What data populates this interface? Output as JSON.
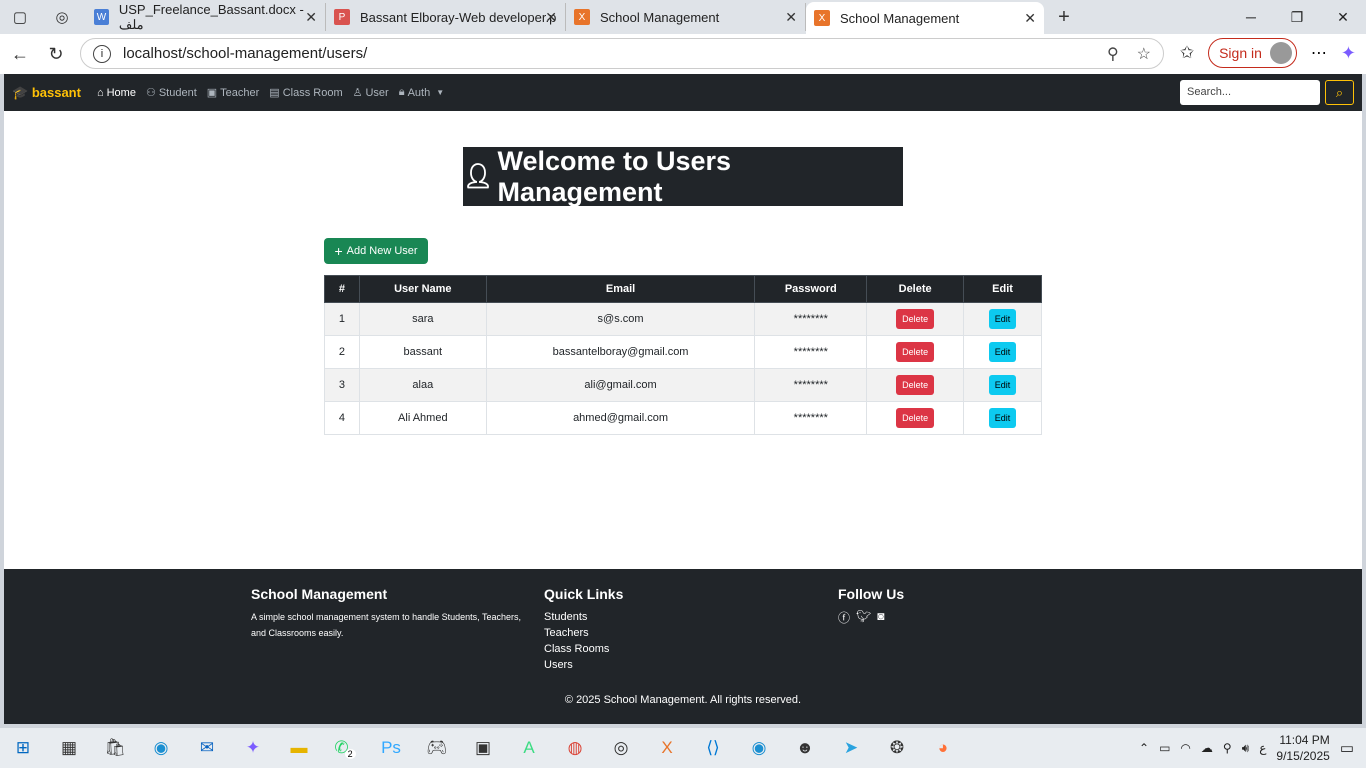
{
  "browser": {
    "tabs": [
      {
        "title": "USP_Freelance_Bassant.docx - ملف",
        "fav": "W",
        "color": "#4a7fd6"
      },
      {
        "title": "Bassant Elboray-Web developer.p",
        "fav": "P",
        "color": "#d9534f"
      },
      {
        "title": "School Management",
        "fav": "X",
        "color": "#e8742a"
      },
      {
        "title": "School Management",
        "fav": "X",
        "color": "#e8742a"
      }
    ],
    "url": "localhost/school-management/users/",
    "signin": "Sign in"
  },
  "navbar": {
    "brand": "bassant",
    "items": [
      "Home",
      "Student",
      "Teacher",
      "Class Room",
      "User",
      "Auth"
    ],
    "search_placeholder": "Search..."
  },
  "main": {
    "title": "Welcome to Users Management",
    "add_button": "Add New User",
    "columns": [
      "#",
      "User Name",
      "Email",
      "Password",
      "Delete",
      "Edit"
    ],
    "rows": [
      {
        "id": "1",
        "name": "sara",
        "email": "s@s.com",
        "password": "********"
      },
      {
        "id": "2",
        "name": "bassant",
        "email": "bassantelboray@gmail.com",
        "password": "********"
      },
      {
        "id": "3",
        "name": "alaa",
        "email": "ali@gmail.com",
        "password": "********"
      },
      {
        "id": "4",
        "name": "Ali Ahmed",
        "email": "ahmed@gmail.com",
        "password": "********"
      }
    ],
    "delete_label": "Delete",
    "edit_label": "Edit"
  },
  "footer": {
    "col1_title": "School Management",
    "col1_text": "A simple school management system to handle Students, Teachers, and Classrooms easily.",
    "col2_title": "Quick Links",
    "links": [
      "Students",
      "Teachers",
      "Class Rooms",
      "Users"
    ],
    "col3_title": "Follow Us",
    "copyright": "© 2025 School Management. All rights reserved."
  },
  "taskbar": {
    "time": "11:04 PM",
    "date": "9/15/2025",
    "lang": "ع",
    "whatsapp_badge": "2"
  }
}
